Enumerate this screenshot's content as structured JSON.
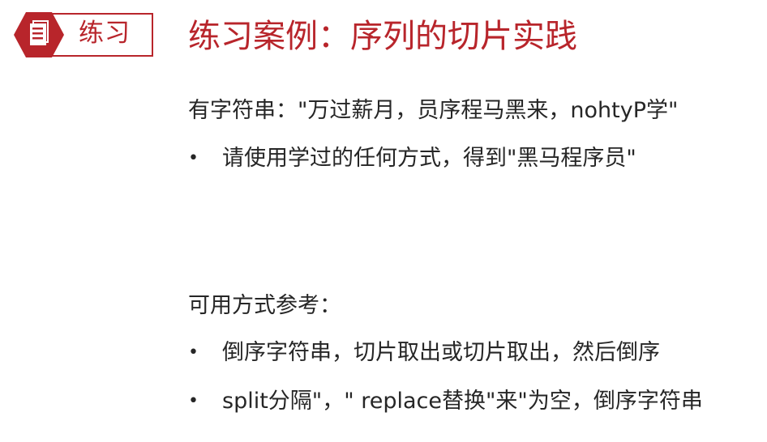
{
  "badge": {
    "icon": "document-icon",
    "label": "练习",
    "color": "#b8252b"
  },
  "title": "练习案例：序列的切片实践",
  "given": "有字符串：\"万过薪月，员序程马黑来，nohtyP学\"",
  "task_bullets": [
    "请使用学过的任何方式，得到\"黑马程序员\""
  ],
  "reference_heading": "可用方式参考：",
  "reference_bullets": [
    "倒序字符串，切片取出或切片取出，然后倒序",
    "split分隔\"，\" replace替换\"来\"为空，倒序字符串"
  ],
  "bullet_char": "•"
}
